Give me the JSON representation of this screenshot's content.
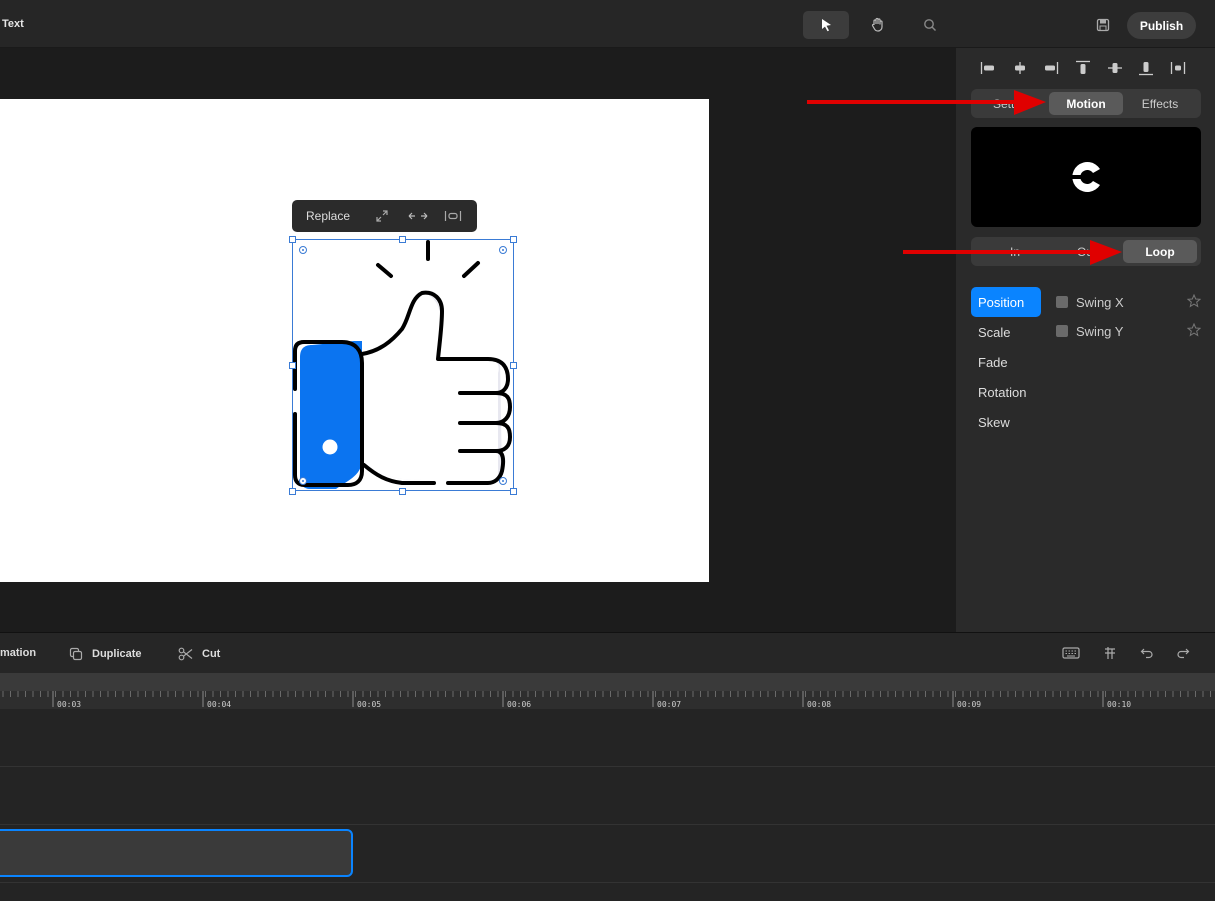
{
  "header": {
    "title": "Text",
    "publish_label": "Publish"
  },
  "canvas_toolbar": {
    "replace_label": "Replace"
  },
  "panel": {
    "main_tabs": [
      {
        "label": "Settings",
        "visible_label": "Settin",
        "active": false
      },
      {
        "label": "Motion",
        "active": true
      },
      {
        "label": "Effects",
        "active": false
      }
    ],
    "motion_tabs": [
      {
        "label": "In",
        "active": false
      },
      {
        "label": "Out",
        "active": false
      },
      {
        "label": "Loop",
        "active": true
      }
    ],
    "loop_types": [
      {
        "label": "Position",
        "active": true
      },
      {
        "label": "Scale",
        "active": false
      },
      {
        "label": "Fade",
        "active": false
      },
      {
        "label": "Rotation",
        "active": false
      },
      {
        "label": "Skew",
        "active": false
      }
    ],
    "options": [
      {
        "label": "Swing X"
      },
      {
        "label": "Swing Y"
      }
    ]
  },
  "bottom_toolbar": {
    "animation_label": "mation",
    "duplicate_label": "Duplicate",
    "cut_label": "Cut"
  },
  "timeline": {
    "ticks": [
      "00:03",
      "00:04",
      "00:05",
      "00:06",
      "00:07",
      "00:08",
      "00:09",
      "00:10"
    ]
  },
  "colors": {
    "accent": "#0a84ff",
    "annotation_arrow": "#e00000",
    "thumb_fill": "#0b74f0"
  },
  "icons": [
    "pointer-icon",
    "hand-icon",
    "search-icon",
    "save-icon",
    "expand-icon",
    "flip-icon",
    "spacing-icon",
    "align-left-icon",
    "align-center-h-icon",
    "align-right-icon",
    "align-top-icon",
    "align-middle-icon",
    "align-bottom-icon",
    "distribute-icon",
    "star-icon",
    "duplicate-icon",
    "scissors-icon",
    "keyboard-icon",
    "snap-icon",
    "undo-icon",
    "redo-icon"
  ]
}
